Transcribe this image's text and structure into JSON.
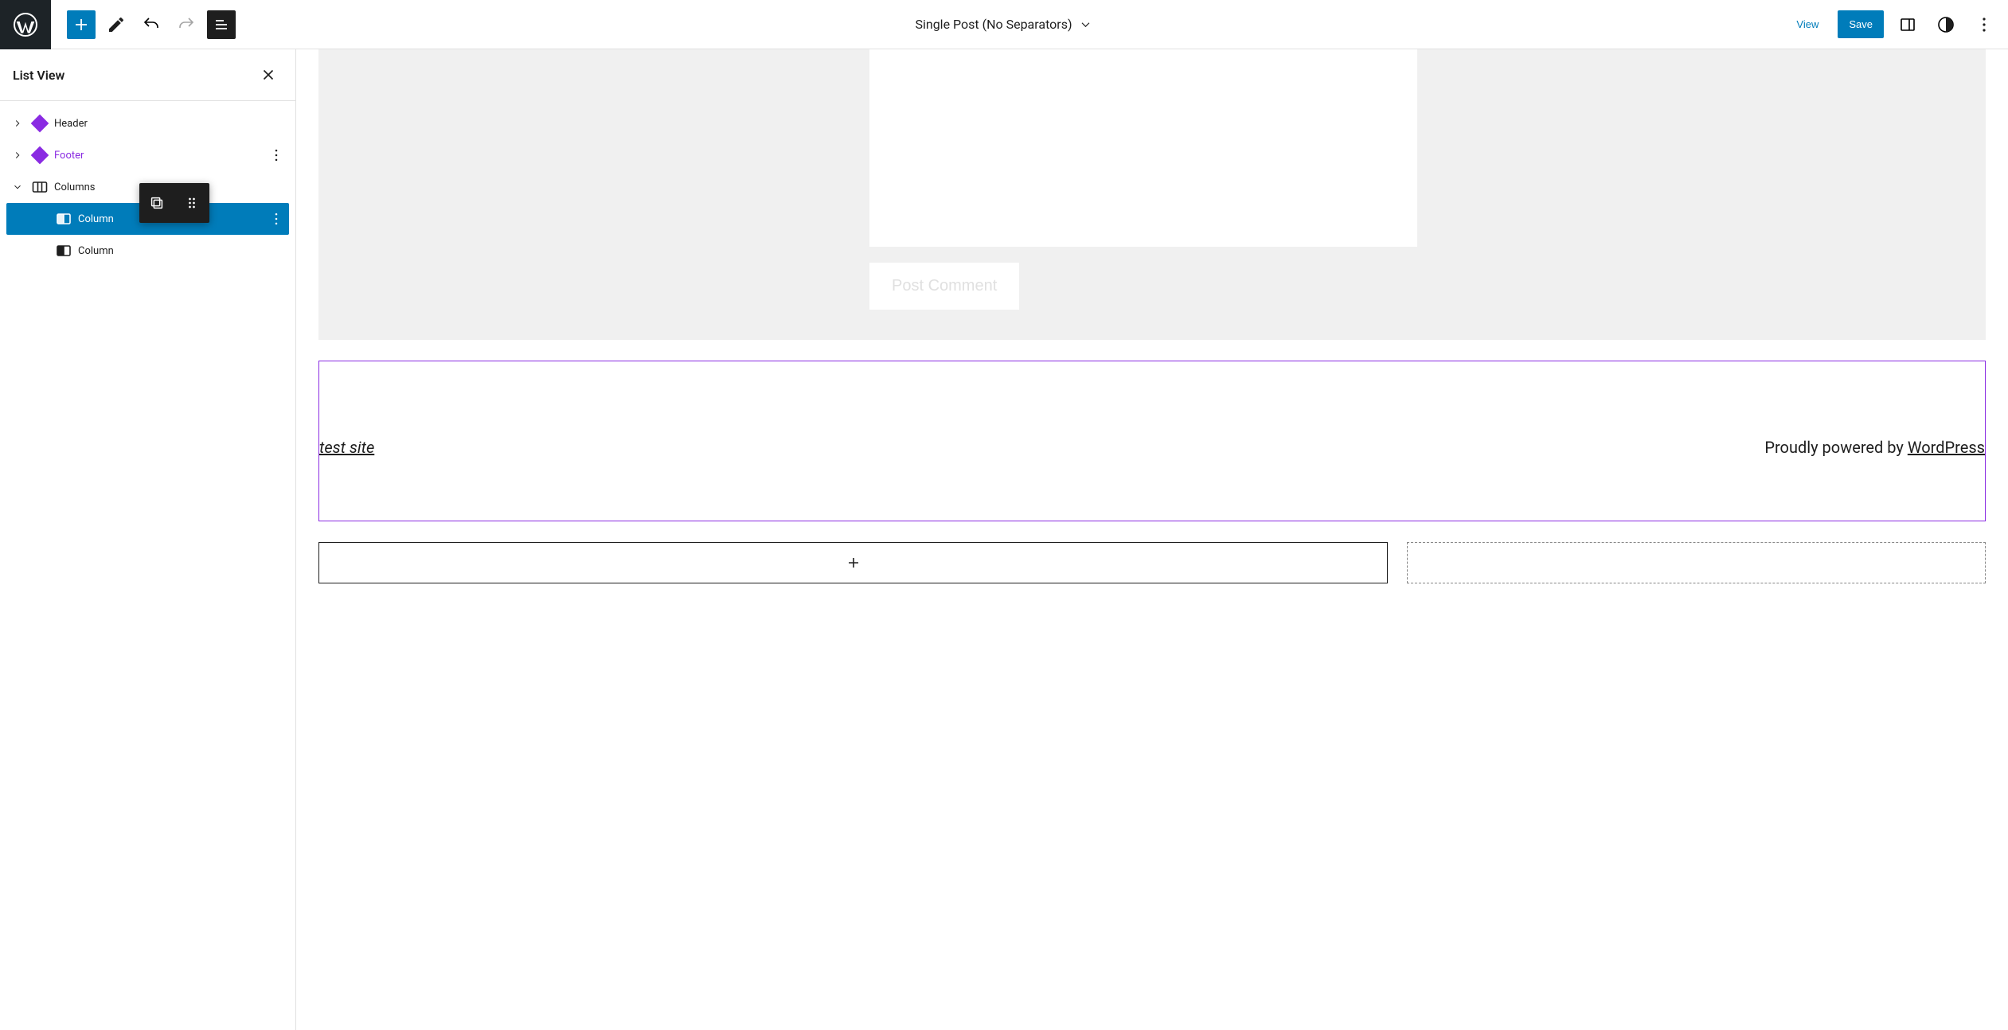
{
  "topbar": {
    "title": "Single Post (No Separators)",
    "view_label": "View",
    "save_label": "Save"
  },
  "list_view": {
    "title": "List View",
    "items": [
      {
        "label": "Header"
      },
      {
        "label": "Footer"
      },
      {
        "label": "Columns"
      },
      {
        "label": "Column"
      },
      {
        "label": "Column"
      }
    ]
  },
  "canvas": {
    "post_comment_label": "Post Comment",
    "footer": {
      "site_title": "test site",
      "powered_by_prefix": "Proudly powered by ",
      "powered_by_link": "WordPress"
    }
  }
}
